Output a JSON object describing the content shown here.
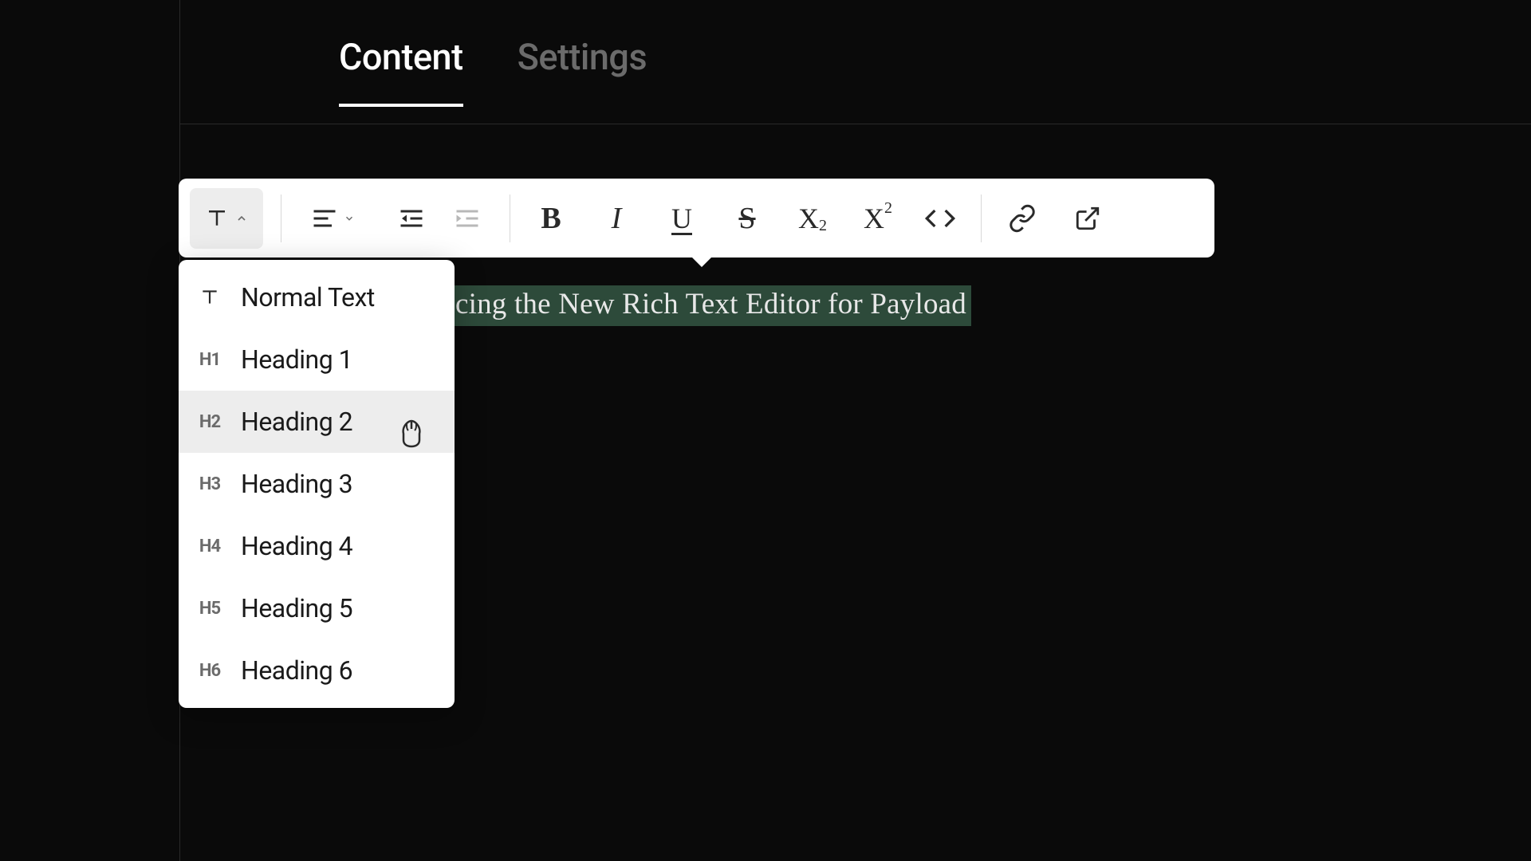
{
  "tabs": {
    "content": "Content",
    "settings": "Settings"
  },
  "editor": {
    "selected_text": "cing the New Rich Text Editor for Payload"
  },
  "text_type_dropdown": {
    "items": [
      {
        "icon": "T",
        "label": "Normal Text"
      },
      {
        "icon": "H1",
        "label": "Heading 1"
      },
      {
        "icon": "H2",
        "label": "Heading 2"
      },
      {
        "icon": "H3",
        "label": "Heading 3"
      },
      {
        "icon": "H4",
        "label": "Heading 4"
      },
      {
        "icon": "H5",
        "label": "Heading 5"
      },
      {
        "icon": "H6",
        "label": "Heading 6"
      }
    ],
    "hovered_index": 2
  },
  "format_letters": {
    "bold": "B",
    "italic": "I",
    "underline": "U",
    "strike": "S",
    "sub_x": "X",
    "sub_2": "2",
    "sup_x": "X",
    "sup_2": "2"
  }
}
